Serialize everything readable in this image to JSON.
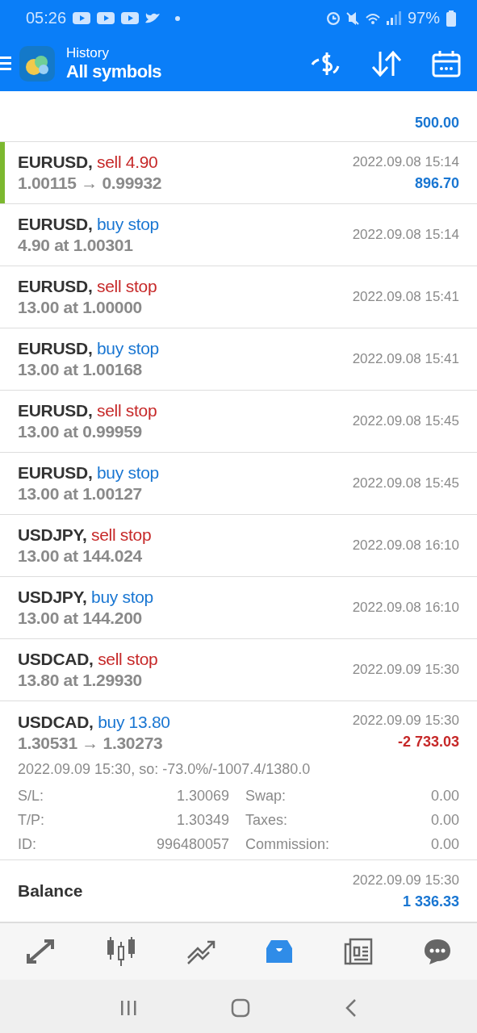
{
  "status_bar": {
    "time": "05:26",
    "battery": "97%"
  },
  "header": {
    "title": "History",
    "subtitle": "All symbols"
  },
  "top_row": {
    "amount": "500.00"
  },
  "rows": [
    {
      "symbol": "EURUSD,",
      "action": "sell 4.90",
      "color": "#c62828",
      "detail": "1.00115 → 0.99932",
      "time": "2022.09.08 15:14",
      "amount": "896.70",
      "marked": true
    },
    {
      "symbol": "EURUSD,",
      "action": "buy stop",
      "color": "#1976d2",
      "detail": "4.90 at 1.00301",
      "time": "2022.09.08 15:14",
      "marked": false
    },
    {
      "symbol": "EURUSD,",
      "action": "sell stop",
      "color": "#c62828",
      "detail": "13.00 at 1.00000",
      "time": "2022.09.08 15:41",
      "marked": false
    },
    {
      "symbol": "EURUSD,",
      "action": "buy stop",
      "color": "#1976d2",
      "detail": "13.00 at 1.00168",
      "time": "2022.09.08 15:41",
      "marked": false
    },
    {
      "symbol": "EURUSD,",
      "action": "sell stop",
      "color": "#c62828",
      "detail": "13.00 at 0.99959",
      "time": "2022.09.08 15:45",
      "marked": false
    },
    {
      "symbol": "EURUSD,",
      "action": "buy stop",
      "color": "#1976d2",
      "detail": "13.00 at 1.00127",
      "time": "2022.09.08 15:45",
      "marked": false
    },
    {
      "symbol": "USDJPY,",
      "action": "sell stop",
      "color": "#c62828",
      "detail": "13.00 at 144.024",
      "time": "2022.09.08 16:10",
      "marked": false
    },
    {
      "symbol": "USDJPY,",
      "action": "buy stop",
      "color": "#1976d2",
      "detail": "13.00 at 144.200",
      "time": "2022.09.08 16:10",
      "marked": false
    },
    {
      "symbol": "USDCAD,",
      "action": "sell stop",
      "color": "#c62828",
      "detail": "13.80 at 1.29930",
      "time": "2022.09.09 15:30",
      "marked": false
    },
    {
      "symbol": "USDCAD,",
      "action": "buy 13.80",
      "color": "#1976d2",
      "detail": "1.30531 → 1.30273",
      "time": "2022.09.09 15:30",
      "amount": "-2 733.03",
      "marked": false,
      "expanded": true,
      "note": "2022.09.09 15:30, so: -73.0%/-1007.4/1380.0",
      "fields": [
        {
          "label": "S/L:",
          "value": "1.30069"
        },
        {
          "label": "Swap:",
          "value": "0.00"
        },
        {
          "label": "T/P:",
          "value": "1.30349"
        },
        {
          "label": "Taxes:",
          "value": "0.00"
        },
        {
          "label": "ID:",
          "value": "996480057"
        },
        {
          "label": "Commission:",
          "value": "0.00"
        }
      ]
    }
  ],
  "balance_row": {
    "label": "Balance",
    "time": "2022.09.09 15:30",
    "amount": "1 336.33"
  },
  "bottom_nav": [
    {
      "kind": "trade",
      "selected": false
    },
    {
      "kind": "quotes",
      "selected": false
    },
    {
      "kind": "chart",
      "selected": false
    },
    {
      "kind": "history",
      "selected": true
    },
    {
      "kind": "news",
      "selected": false
    },
    {
      "kind": "chat",
      "selected": false
    }
  ]
}
